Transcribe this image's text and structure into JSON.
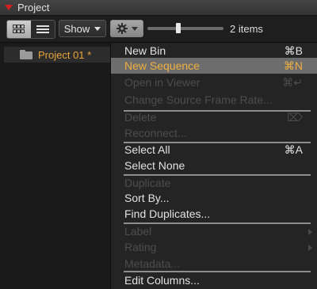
{
  "panel": {
    "title": "Project"
  },
  "toolbar": {
    "show_label": "Show",
    "items_count": "2 items",
    "thumb_size_fraction": 0.4
  },
  "sidebar": {
    "items": [
      {
        "label": "Project 01 *"
      }
    ]
  },
  "colors": {
    "accent_orange": "#f0b03f",
    "highlight_bg": "#6d6d6d",
    "close_triangle": "#d42020"
  },
  "menu": {
    "new_bin": {
      "label": "New Bin",
      "shortcut": "⌘B"
    },
    "new_sequence": {
      "label": "New Sequence",
      "shortcut": "⌘N"
    },
    "open_in_viewer": {
      "label": "Open in Viewer",
      "shortcut": "⌘↵"
    },
    "change_source_frame_rate": {
      "label": "Change Source Frame Rate..."
    },
    "delete": {
      "label": "Delete",
      "shortcut": "⌦"
    },
    "reconnect": {
      "label": "Reconnect..."
    },
    "select_all": {
      "label": "Select All",
      "shortcut": "⌘A"
    },
    "select_none": {
      "label": "Select None"
    },
    "duplicate": {
      "label": "Duplicate"
    },
    "sort_by": {
      "label": "Sort By..."
    },
    "find_duplicates": {
      "label": "Find Duplicates..."
    },
    "label": {
      "label": "Label"
    },
    "rating": {
      "label": "Rating"
    },
    "metadata": {
      "label": "Metadata..."
    },
    "edit_columns": {
      "label": "Edit Columns..."
    }
  }
}
